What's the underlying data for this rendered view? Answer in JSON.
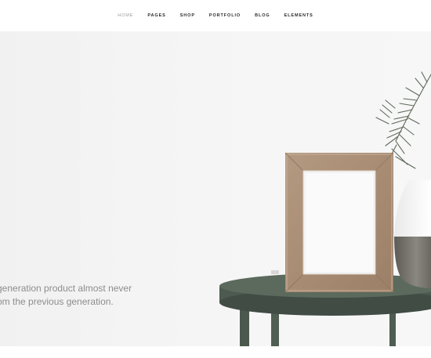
{
  "nav": {
    "items": [
      {
        "label": "HOME",
        "active": true
      },
      {
        "label": "PAGES",
        "active": false
      },
      {
        "label": "SHOP",
        "active": false
      },
      {
        "label": "PORTFOLIO",
        "active": false
      },
      {
        "label": "BLOG",
        "active": false
      },
      {
        "label": "ELEMENTS",
        "active": false
      }
    ]
  },
  "hero": {
    "line1": "generation product almost never",
    "line2": "om the previous generation."
  },
  "colors": {
    "active_nav": "#9a9a9a",
    "nav_text": "#2b2b2b",
    "hero_text": "#8d8d8d",
    "table_green": "#4f5d51"
  }
}
